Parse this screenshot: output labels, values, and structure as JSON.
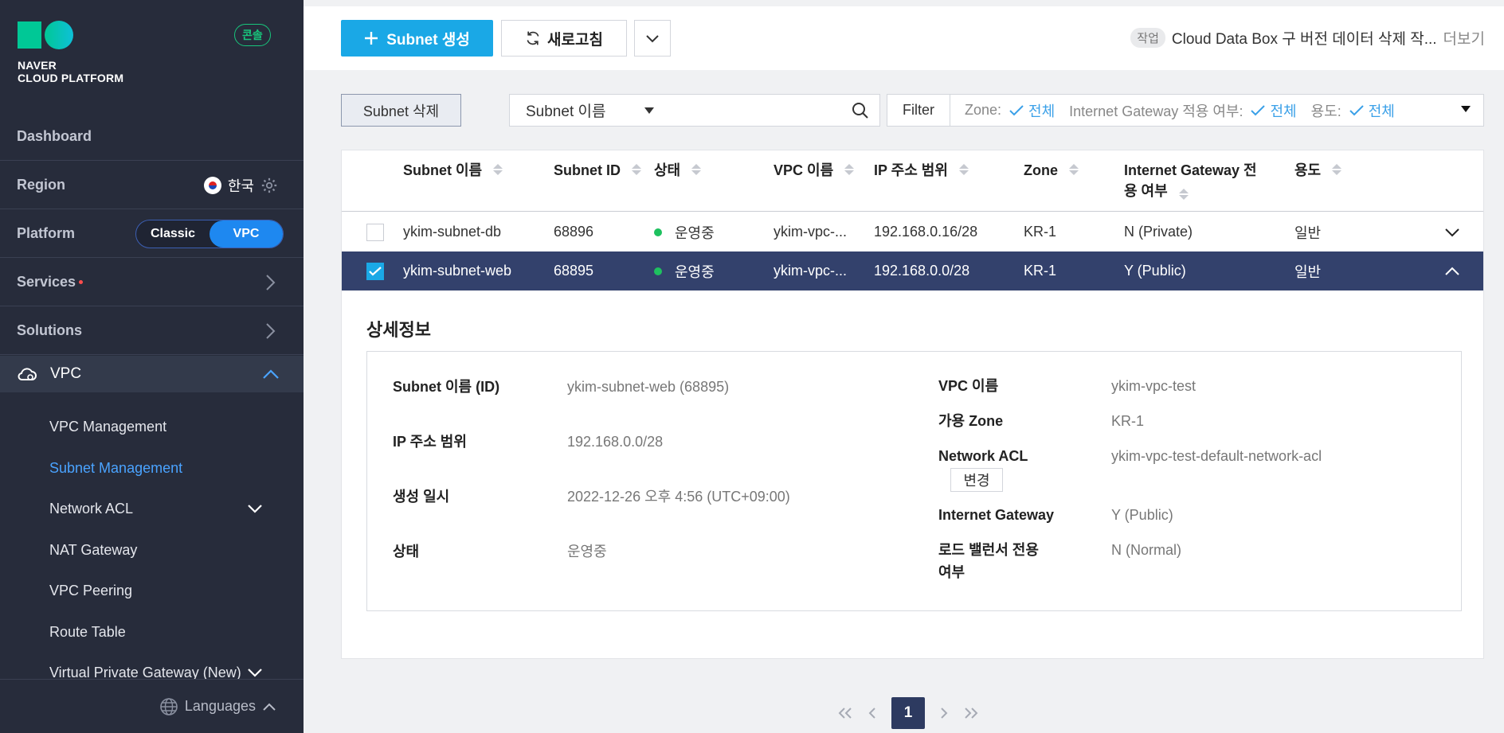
{
  "sidebar": {
    "logo_text_1": "NAVER",
    "logo_text_2": "CLOUD PLATFORM",
    "console_badge": "콘솔",
    "dashboard": "Dashboard",
    "region_label": "Region",
    "region_value": "한국",
    "platform_label": "Platform",
    "platform_options": [
      "Classic",
      "VPC"
    ],
    "platform_selected": "VPC",
    "services": "Services",
    "solutions": "Solutions",
    "vpc": "VPC",
    "vpc_menu": [
      "VPC Management",
      "Subnet Management",
      "Network ACL",
      "NAT Gateway",
      "VPC Peering",
      "Route Table",
      "Virtual Private Gateway (New)"
    ],
    "vpc_menu_active": "Subnet Management",
    "languages": "Languages"
  },
  "topbar": {
    "create_label": "Subnet 생성",
    "refresh_label": "새로고침",
    "task_tag": "작업",
    "task_text": "Cloud Data Box 구 버전 데이터 삭제 작...",
    "task_more": "더보기"
  },
  "toolbar": {
    "delete_label": "Subnet 삭제",
    "search_field": "Subnet 이름",
    "search_value": "",
    "filter_label": "Filter",
    "filters": [
      {
        "name": "Zone:",
        "value": "전체"
      },
      {
        "name": "Internet Gateway 적용 여부:",
        "value": "전체"
      },
      {
        "name": "용도:",
        "value": "전체"
      }
    ]
  },
  "table": {
    "headers": [
      "Subnet 이름",
      "Subnet ID",
      "상태",
      "VPC 이름",
      "IP 주소 범위",
      "Zone",
      "Internet Gateway 전용 여부",
      "용도"
    ],
    "header_igw_line1": "Internet Gateway 전",
    "header_igw_line2": "용 여부",
    "rows": [
      {
        "name": "ykim-subnet-db",
        "id": "68896",
        "status": "운영중",
        "vpc": "ykim-vpc-...",
        "ip": "192.168.0.16/28",
        "zone": "KR-1",
        "igw": "N (Private)",
        "usage": "일반",
        "selected": false
      },
      {
        "name": "ykim-subnet-web",
        "id": "68895",
        "status": "운영중",
        "vpc": "ykim-vpc-...",
        "ip": "192.168.0.0/28",
        "zone": "KR-1",
        "igw": "Y (Public)",
        "usage": "일반",
        "selected": true
      }
    ]
  },
  "detail": {
    "title": "상세정보",
    "subnet_name_label": "Subnet 이름 (ID)",
    "subnet_name_value": "ykim-subnet-web (68895)",
    "ip_label": "IP 주소 범위",
    "ip_value": "192.168.0.0/28",
    "created_label": "생성 일시",
    "created_value": "2022-12-26 오후 4:56 (UTC+09:00)",
    "status_label": "상태",
    "status_value": "운영중",
    "vpc_label": "VPC 이름",
    "vpc_value": "ykim-vpc-test",
    "zone_label": "가용 Zone",
    "zone_value": "KR-1",
    "acl_label": "Network ACL",
    "acl_value": "ykim-vpc-test-default-network-acl",
    "acl_change": "변경",
    "igw_label": "Internet Gateway",
    "igw_value": "Y (Public)",
    "lb_label_1": "로드 밸런서 전용",
    "lb_label_2": "여부",
    "lb_value": "N (Normal)"
  },
  "pagination": {
    "current": "1"
  }
}
